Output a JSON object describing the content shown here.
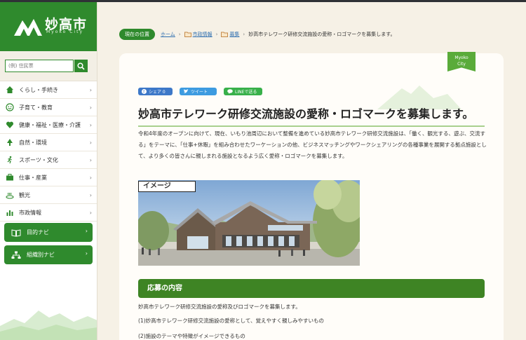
{
  "logo": {
    "title": "妙高市",
    "subtitle": "Myoko City"
  },
  "search": {
    "placeholder": "(例) 住民票"
  },
  "menu": [
    {
      "label": "くらし・手続き",
      "icon": "house-icon"
    },
    {
      "label": "子育て・教育",
      "icon": "smile-icon"
    },
    {
      "label": "健康・福祉・医療・介護",
      "icon": "heart-icon"
    },
    {
      "label": "自然・環境",
      "icon": "tree-icon"
    },
    {
      "label": "スポーツ・文化",
      "icon": "runner-icon"
    },
    {
      "label": "仕事・産業",
      "icon": "briefcase-icon"
    },
    {
      "label": "観光",
      "icon": "onsen-icon"
    },
    {
      "label": "市政情報",
      "icon": "bar-chart-icon"
    }
  ],
  "navi": [
    {
      "label": "目的ナビ",
      "icon": "book-icon"
    },
    {
      "label": "組織別ナビ",
      "icon": "org-chart-icon"
    }
  ],
  "breadcrumb": {
    "current_label": "現在の位置",
    "items": [
      "ホーム",
      "市政情報",
      "募集",
      "妙高市テレワーク研修交流施設の愛称・ロゴマークを募集します。"
    ]
  },
  "tag": {
    "line1": "Myoko",
    "line2": "City"
  },
  "share": {
    "facebook": "シェア 0",
    "twitter": "ツイート",
    "line": "LINEで送る"
  },
  "article": {
    "title": "妙高市テレワーク研修交流施設の愛称・ロゴマークを募集します。",
    "lead": "令和4年度のオープンに向けて、現在、いもり池周辺において整備を進めている妙高市テレワーク研修交流施設は、「働く、観光する、遊ぶ、交流する」をテーマに、「仕事+休暇」を組み合わせたワーケーションの他、ビジネスマッチングやワークシェアリングの各種事業を展開する拠点施設として、より多くの皆さんに親しまれる施設となるよう広く愛称・ロゴマークを募集します。",
    "image_label": "イメージ",
    "section_title": "応募の内容",
    "lines": [
      "妙高市テレワーク研修交流施設の愛称及びロゴマークを募集します。",
      "(1)妙高市テレワーク研修交流施設の愛称として、覚えやすく親しみやすいもの",
      "(2)施設のテーマや特徴がイメージできるもの"
    ]
  },
  "colors": {
    "brand_green": "#2f8a2d",
    "section_green": "#3e8424",
    "background": "#f6f1e6"
  }
}
